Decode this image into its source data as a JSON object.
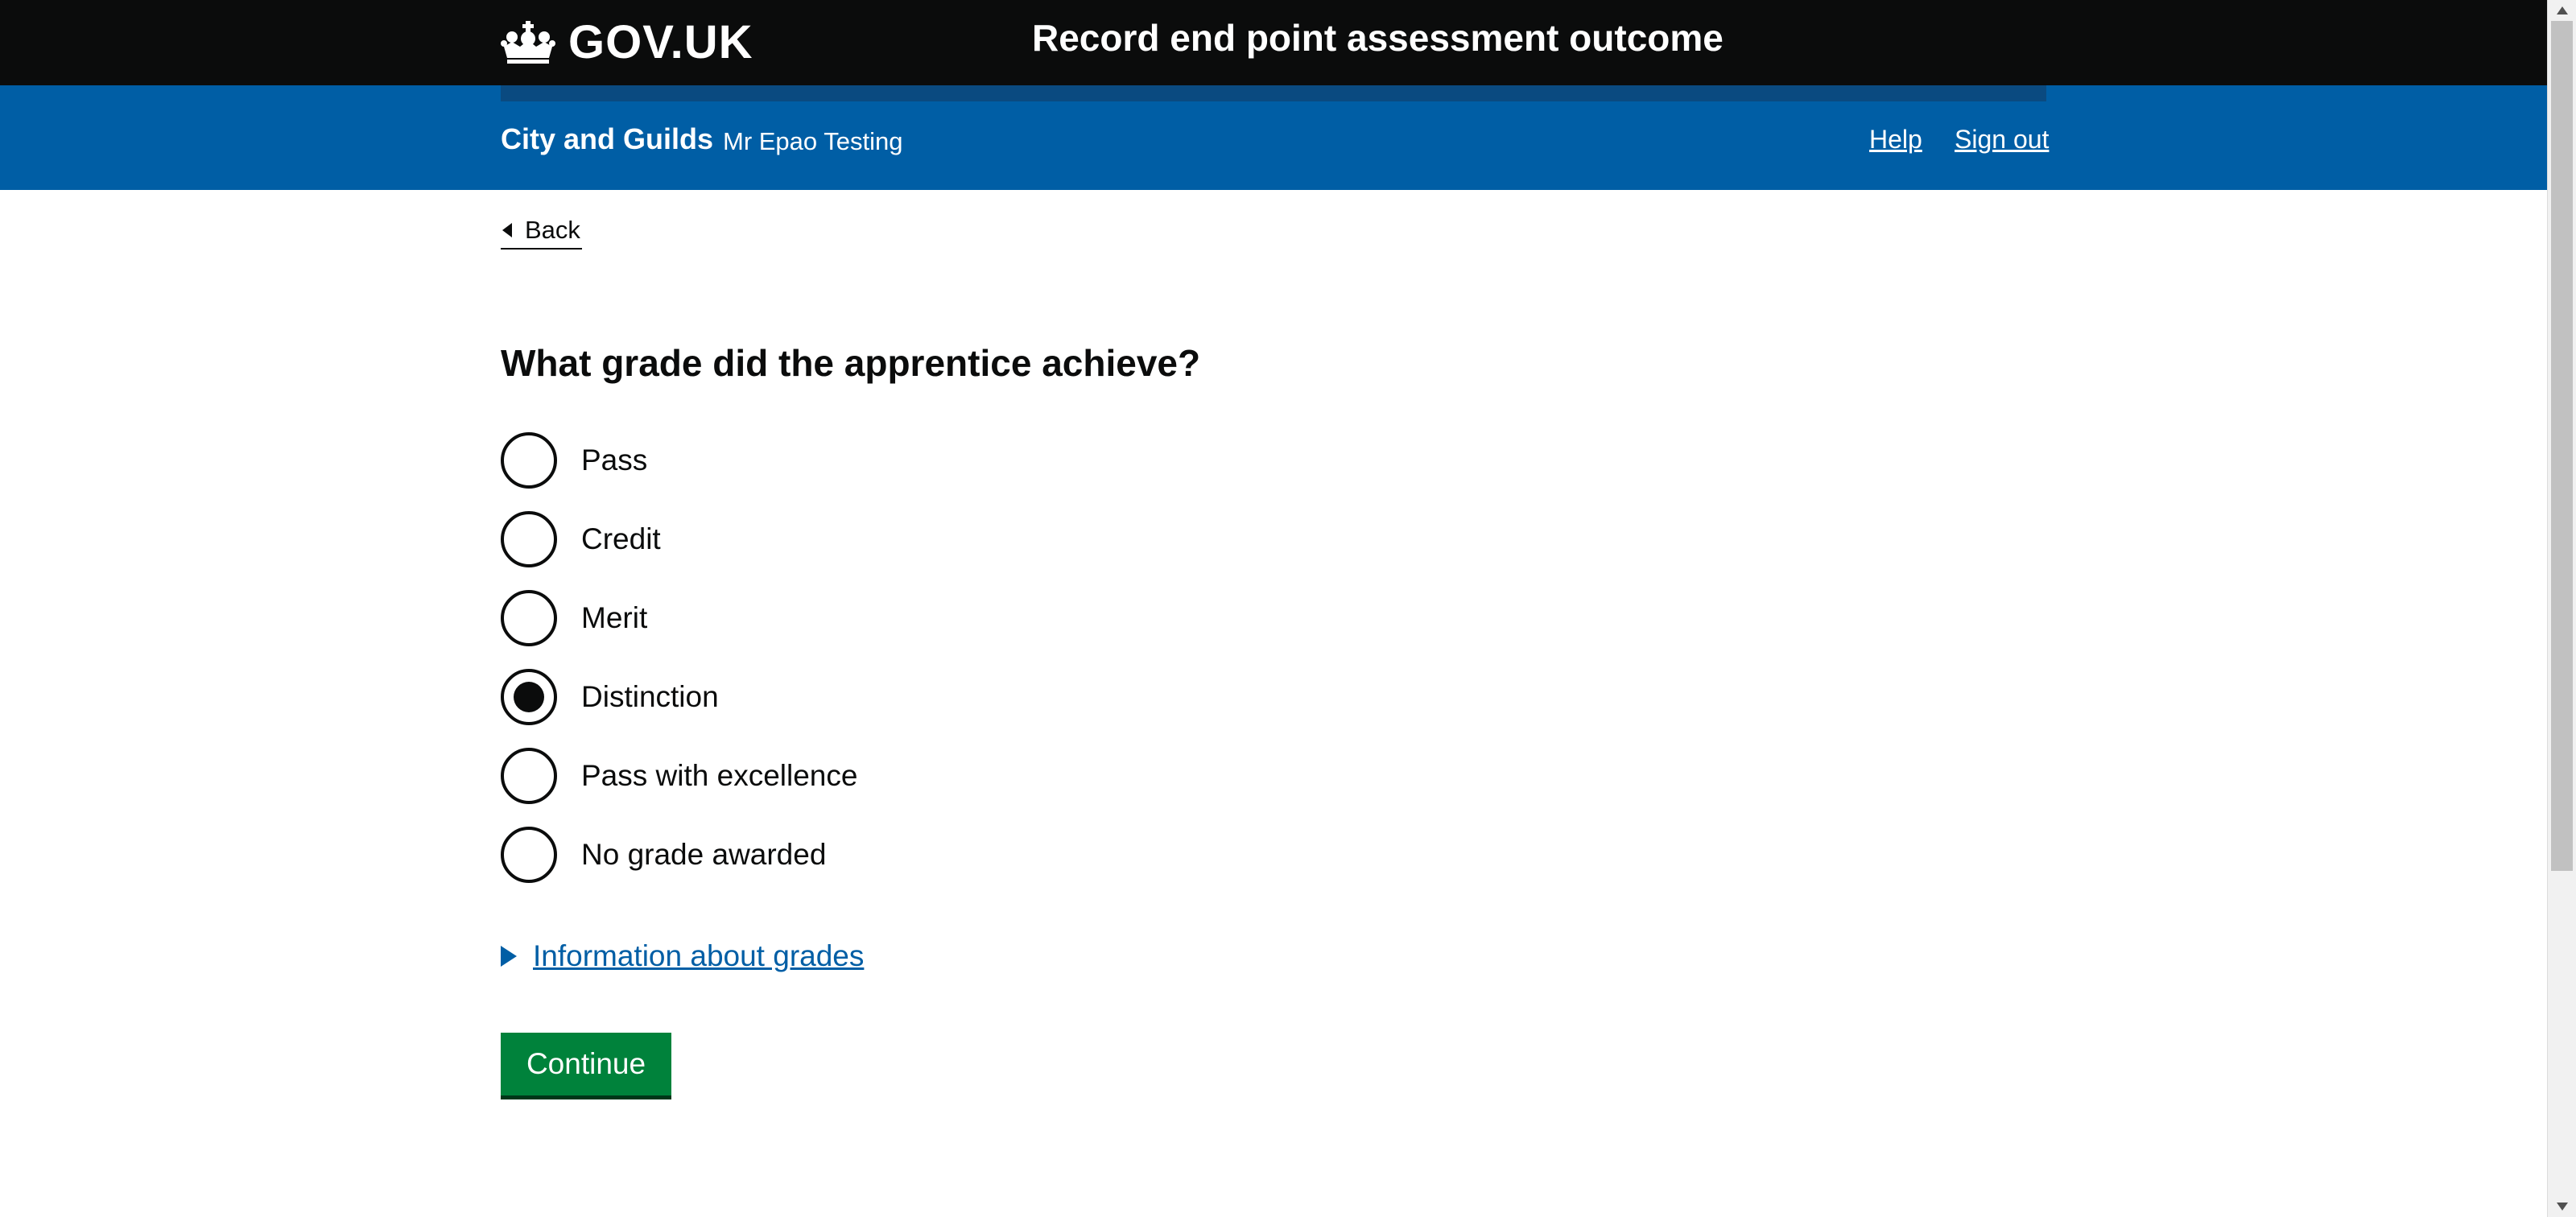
{
  "header": {
    "logo_text": "GOV.UK",
    "logo_icon": "crown-icon",
    "service_name": "Record end point assessment outcome"
  },
  "subheader": {
    "organisation": "City and Guilds",
    "user": "Mr Epao Testing",
    "links": {
      "help": "Help",
      "sign_out": "Sign out"
    }
  },
  "back_link": {
    "label": "Back",
    "icon": "chevron-left-icon"
  },
  "form": {
    "question": "What grade did the apprentice achieve?",
    "options": [
      {
        "label": "Pass",
        "selected": false
      },
      {
        "label": "Credit",
        "selected": false
      },
      {
        "label": "Merit",
        "selected": false
      },
      {
        "label": "Distinction",
        "selected": true
      },
      {
        "label": "Pass with excellence",
        "selected": false
      },
      {
        "label": "No grade awarded",
        "selected": false
      }
    ],
    "details_label": "Information about grades",
    "details_icon": "triangle-right-icon",
    "submit_label": "Continue"
  },
  "colors": {
    "header_black": "#0b0c0c",
    "brand_blue": "#005ea5",
    "link_blue": "#005ea5",
    "button_green": "#00823b"
  }
}
